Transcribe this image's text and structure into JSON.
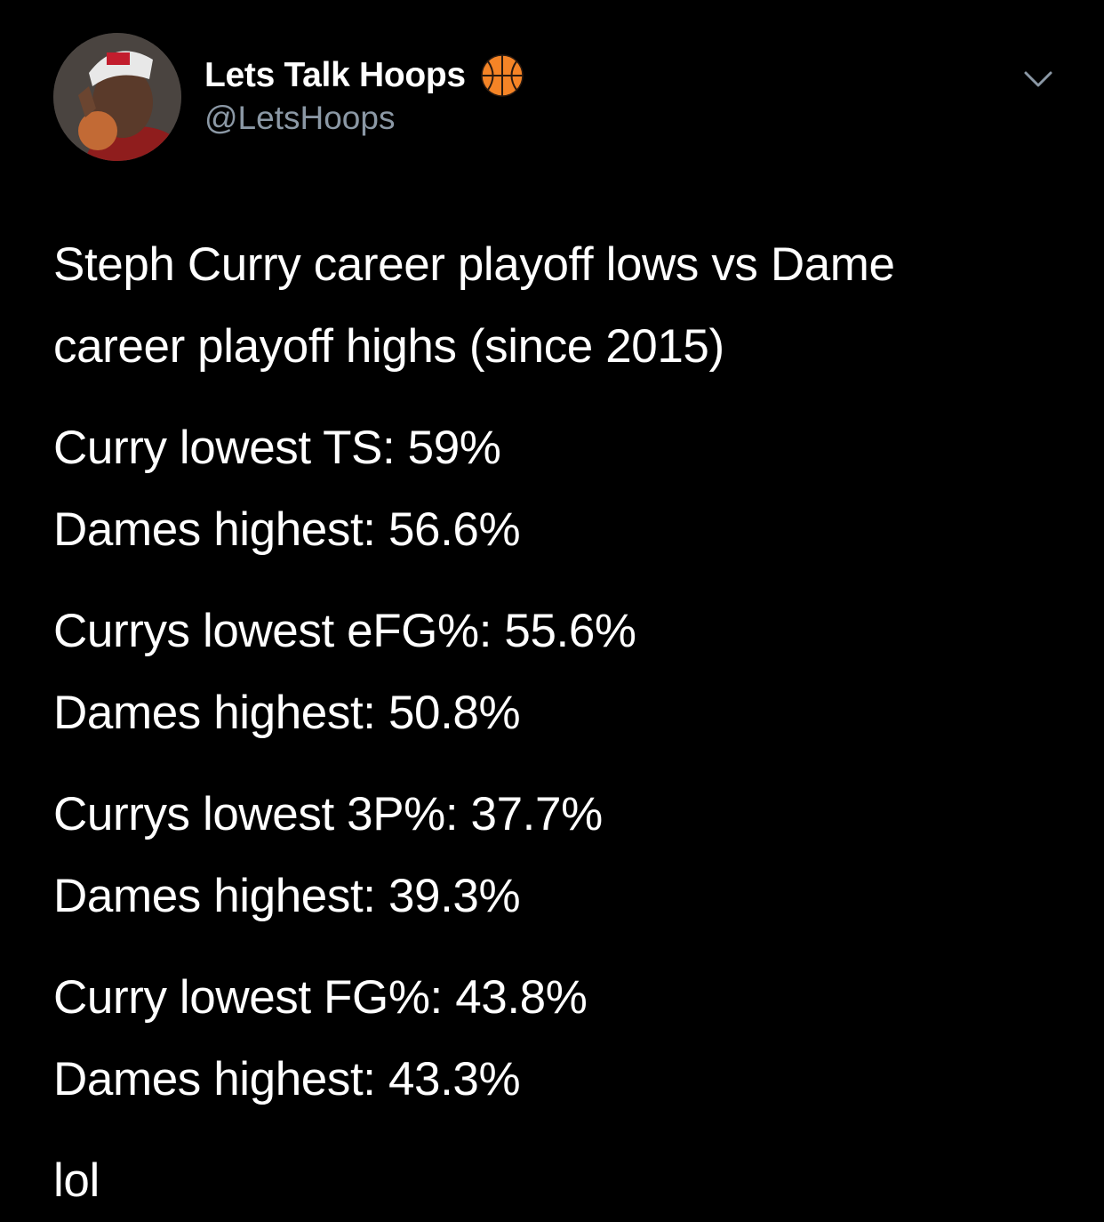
{
  "author": {
    "display_name": "Lets Talk Hoops",
    "handle": "@LetsHoops",
    "badge_icon": "basketball-icon",
    "menu_icon": "chevron-down-icon"
  },
  "tweet": {
    "intro": [
      "Steph Curry career playoff lows vs Dame",
      "career playoff highs (since 2015)"
    ],
    "stats": [
      {
        "curry": "Curry lowest TS: 59%",
        "dame": "Dames highest: 56.6%"
      },
      {
        "curry": "Currys lowest eFG%: 55.6%",
        "dame": "Dames highest: 50.8%"
      },
      {
        "curry": "Currys lowest 3P%: 37.7%",
        "dame": "Dames highest: 39.3%"
      },
      {
        "curry": "Curry lowest FG%: 43.8%",
        "dame": "Dames highest: 43.3%"
      }
    ],
    "closing": "lol"
  },
  "colors": {
    "background": "#000000",
    "text": "#ffffff",
    "secondary_text": "#8b98a5",
    "basketball": "#f58426"
  }
}
